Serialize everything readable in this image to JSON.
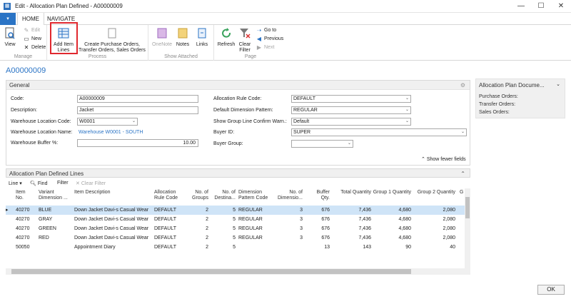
{
  "window": {
    "title": "Edit - Allocation Plan Defined - A00000009",
    "minimize": "—",
    "maximize": "☐",
    "close": "✕"
  },
  "ribbon_tabs": {
    "app_menu": "▾",
    "home": "HOME",
    "navigate": "NAVIGATE"
  },
  "ribbon": {
    "manage": {
      "label": "Manage",
      "view": "View",
      "edit": "Edit",
      "new": "New",
      "delete": "Delete"
    },
    "process": {
      "label": "Process",
      "add_item_lines": "Add Item Lines",
      "create_orders": "Create Purchase Orders, Transfer Orders, Sales Orders"
    },
    "show_attached": {
      "label": "Show Attached",
      "onenote": "OneNote",
      "notes": "Notes",
      "links": "Links"
    },
    "page": {
      "label": "Page",
      "refresh": "Refresh",
      "clear_filter": "Clear Filter",
      "go_to": "Go to",
      "previous": "Previous",
      "next": "Next"
    }
  },
  "page_id": "A00000009",
  "general": {
    "header": "General",
    "code_label": "Code:",
    "code_value": "A00000009",
    "description_label": "Description:",
    "description_value": "Jacket",
    "warehouse_location_code_label": "Warehouse Location Code:",
    "warehouse_location_code_value": "W0001",
    "warehouse_location_name_label": "Warehouse Location Name:",
    "warehouse_location_name_value": "Warehouse W0001 - SOUTH",
    "warehouse_buffer_label": "Warehouse Buffer %:",
    "warehouse_buffer_value": "10.00",
    "allocation_rule_code_label": "Allocation Rule Code:",
    "allocation_rule_code_value": "DEFAULT",
    "default_dimension_pattern_label": "Default Dimension Pattern:",
    "default_dimension_pattern_value": "REGULAR",
    "show_group_line_label": "Show Group Line Confirm Warn.:",
    "show_group_line_value": "Default",
    "buyer_id_label": "Buyer ID:",
    "buyer_id_value": "SUPER",
    "buyer_group_label": "Buyer Group:",
    "buyer_group_value": "",
    "show_fewer": "Show fewer fields"
  },
  "side_panel": {
    "title": "Allocation Plan Docume...",
    "purchase_orders": "Purchase Orders:",
    "transfer_orders": "Transfer Orders:",
    "sales_orders": "Sales Orders:"
  },
  "lines": {
    "header": "Allocation Plan Defined Lines",
    "toolbar": {
      "line": "Line",
      "find": "Find",
      "filter": "Filter",
      "clear_filter": "Clear Filter"
    },
    "columns": {
      "item_no": "Item No.",
      "variant": "Variant Dimension ...",
      "item_description": "Item Description",
      "allocation_rule_code": "Allocation Rule Code",
      "no_groups": "No. of Groups",
      "no_destinations": "No. of Destina...",
      "dimension_pattern_code": "Dimension Pattern Code",
      "no_dimension": "No. of Dimensio...",
      "buffer_qty": "Buffer Qty.",
      "total_quantity": "Total Quantity",
      "group1_quantity": "Group 1 Quantity",
      "group2_quantity": "Group 2 Quantity",
      "g_more": "G"
    },
    "rows": [
      {
        "item_no": "40270",
        "variant": "BLUE",
        "desc": "Down Jacket Davi-s Casual Wear",
        "rule": "DEFAULT",
        "groups": "2",
        "dest": "5",
        "pattern": "REGULAR",
        "dims": "3",
        "buffer": "676",
        "total": "7,436",
        "g1": "4,680",
        "g2": "2,080"
      },
      {
        "item_no": "40270",
        "variant": "GRAY",
        "desc": "Down Jacket Davi-s Casual Wear",
        "rule": "DEFAULT",
        "groups": "2",
        "dest": "5",
        "pattern": "REGULAR",
        "dims": "3",
        "buffer": "676",
        "total": "7,436",
        "g1": "4,680",
        "g2": "2,080"
      },
      {
        "item_no": "40270",
        "variant": "GREEN",
        "desc": "Down Jacket Davi-s Casual Wear",
        "rule": "DEFAULT",
        "groups": "2",
        "dest": "5",
        "pattern": "REGULAR",
        "dims": "3",
        "buffer": "676",
        "total": "7,436",
        "g1": "4,680",
        "g2": "2,080"
      },
      {
        "item_no": "40270",
        "variant": "RED",
        "desc": "Down Jacket Davi-s Casual Wear",
        "rule": "DEFAULT",
        "groups": "2",
        "dest": "5",
        "pattern": "REGULAR",
        "dims": "3",
        "buffer": "676",
        "total": "7,436",
        "g1": "4,680",
        "g2": "2,080"
      },
      {
        "item_no": "50050",
        "variant": "",
        "desc": "Appointment Diary",
        "rule": "DEFAULT",
        "groups": "2",
        "dest": "5",
        "pattern": "",
        "dims": "",
        "buffer": "13",
        "total": "143",
        "g1": "90",
        "g2": "40"
      }
    ]
  },
  "ok_button": "OK",
  "colors": {
    "accent": "#2b74c5",
    "selected_row": "#cfe4f7",
    "highlight": "#e0282e"
  }
}
